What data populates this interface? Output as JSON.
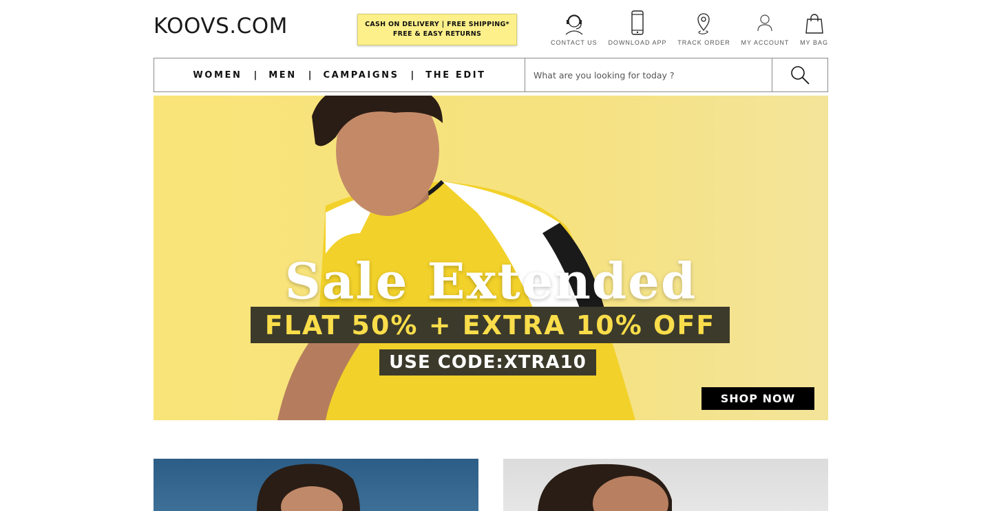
{
  "header": {
    "logo": "KOOVS.COM",
    "promo_line1": "CASH ON DELIVERY | FREE SHIPPING*",
    "promo_line2": "FREE & EASY RETURNS",
    "utilities": [
      {
        "label": "CONTACT US",
        "icon": "headset-icon"
      },
      {
        "label": "DOWNLOAD APP",
        "icon": "mobile-phone-icon"
      },
      {
        "label": "TRACK ORDER",
        "icon": "location-pin-icon"
      },
      {
        "label": "MY ACCOUNT",
        "icon": "user-icon"
      },
      {
        "label": "MY BAG",
        "icon": "shopping-bag-icon"
      }
    ]
  },
  "nav": {
    "items": [
      "WOMEN",
      "MEN",
      "CAMPAIGNS",
      "THE EDIT"
    ],
    "separator": "|",
    "search_placeholder": "What are you looking for today ?",
    "search_icon": "search-icon"
  },
  "hero": {
    "headline": "Sale Extended",
    "offer": "FLAT 50% + EXTRA 10% OFF",
    "code": "USE CODE:XTRA10",
    "cta": "SHOP NOW",
    "colors": {
      "background": "#f6e27f",
      "offer_text": "#f9dd4a",
      "badge_bg": "#3c3a2b"
    }
  }
}
